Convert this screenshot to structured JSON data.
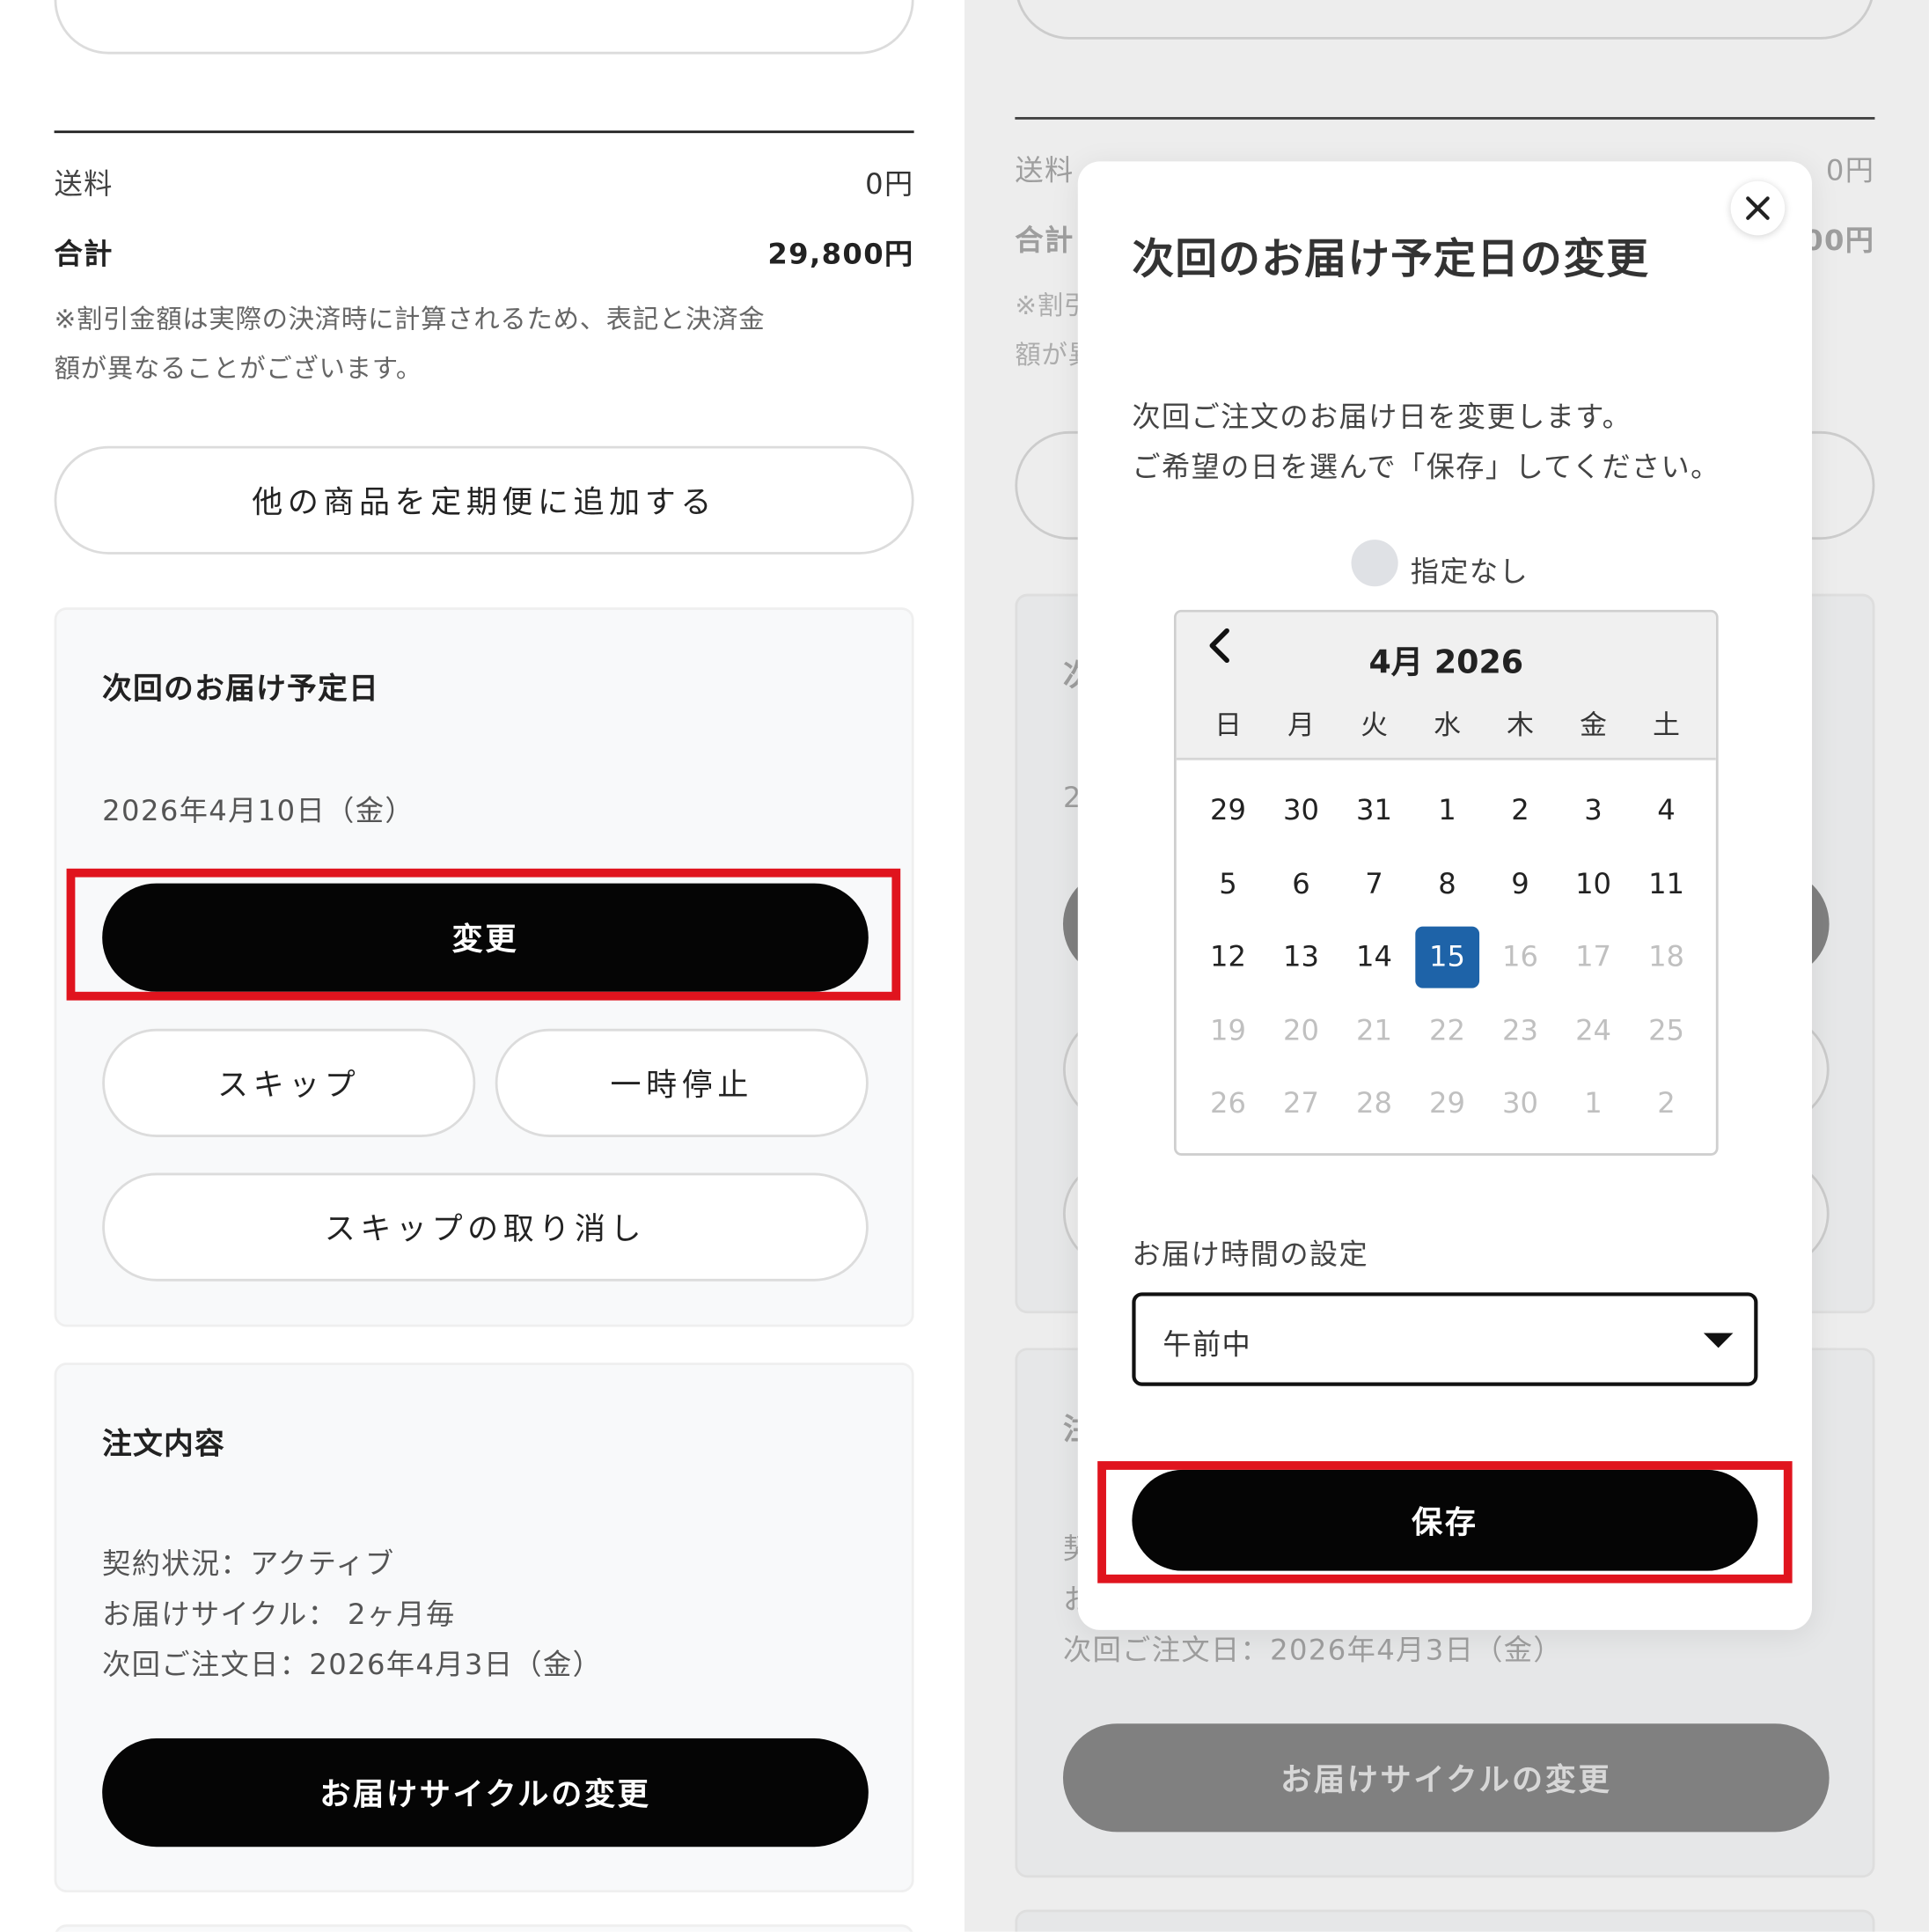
{
  "left": {
    "shipping_label": "送料",
    "shipping_value": "0円",
    "total_label": "合計",
    "total_value": "29,800円",
    "note_line1": "※割引金額は実際の決済時に計算されるため、表記と決済金",
    "note_line2": "額が異なることがございます。",
    "add_product_button": "他の商品を定期便に追加する",
    "next_delivery": {
      "title": "次回のお届け予定日",
      "date": "2026年4月10日（金）",
      "change_button": "変更",
      "skip_button": "スキップ",
      "pause_button": "一時停止",
      "cancel_skip_button": "スキップの取り消し"
    },
    "order": {
      "title": "注文内容",
      "status": "契約状況：アクティブ",
      "cycle": "お届けサイクル： 2ヶ月毎",
      "next_order_date": "次回ご注文日：2026年4月3日（金）",
      "change_cycle_button": "お届けサイクルの変更"
    }
  },
  "modal": {
    "title": "次回のお届け予定日の変更",
    "desc_line1": "次回ご注文のお届け日を変更します。",
    "desc_line2": "ご希望の日を選んで「保存」してください。",
    "no_date_label": "指定なし",
    "calendar": {
      "month_label": "4月 2026",
      "weekdays": [
        "日",
        "月",
        "火",
        "水",
        "木",
        "金",
        "土"
      ],
      "weeks": [
        [
          {
            "d": "29",
            "m": false
          },
          {
            "d": "30",
            "m": false
          },
          {
            "d": "31",
            "m": false
          },
          {
            "d": "1",
            "m": false
          },
          {
            "d": "2",
            "m": false
          },
          {
            "d": "3",
            "m": false
          },
          {
            "d": "4",
            "m": false
          }
        ],
        [
          {
            "d": "5",
            "m": false
          },
          {
            "d": "6",
            "m": false
          },
          {
            "d": "7",
            "m": false
          },
          {
            "d": "8",
            "m": false
          },
          {
            "d": "9",
            "m": false
          },
          {
            "d": "10",
            "m": false
          },
          {
            "d": "11",
            "m": false
          }
        ],
        [
          {
            "d": "12",
            "m": false
          },
          {
            "d": "13",
            "m": false
          },
          {
            "d": "14",
            "m": false
          },
          {
            "d": "15",
            "m": false,
            "sel": true
          },
          {
            "d": "16",
            "m": true
          },
          {
            "d": "17",
            "m": true
          },
          {
            "d": "18",
            "m": true
          }
        ],
        [
          {
            "d": "19",
            "m": true
          },
          {
            "d": "20",
            "m": true
          },
          {
            "d": "21",
            "m": true
          },
          {
            "d": "22",
            "m": true
          },
          {
            "d": "23",
            "m": true
          },
          {
            "d": "24",
            "m": true
          },
          {
            "d": "25",
            "m": true
          }
        ],
        [
          {
            "d": "26",
            "m": true
          },
          {
            "d": "27",
            "m": true
          },
          {
            "d": "28",
            "m": true
          },
          {
            "d": "29",
            "m": true
          },
          {
            "d": "30",
            "m": true
          },
          {
            "d": "1",
            "m": true
          },
          {
            "d": "2",
            "m": true
          }
        ]
      ]
    },
    "time_label": "お届け時間の設定",
    "time_value": "午前中",
    "save_button": "保存"
  },
  "colors": {
    "highlight_red": "#e0141e",
    "selected_day": "#1e63a8",
    "button_black": "#050505"
  }
}
